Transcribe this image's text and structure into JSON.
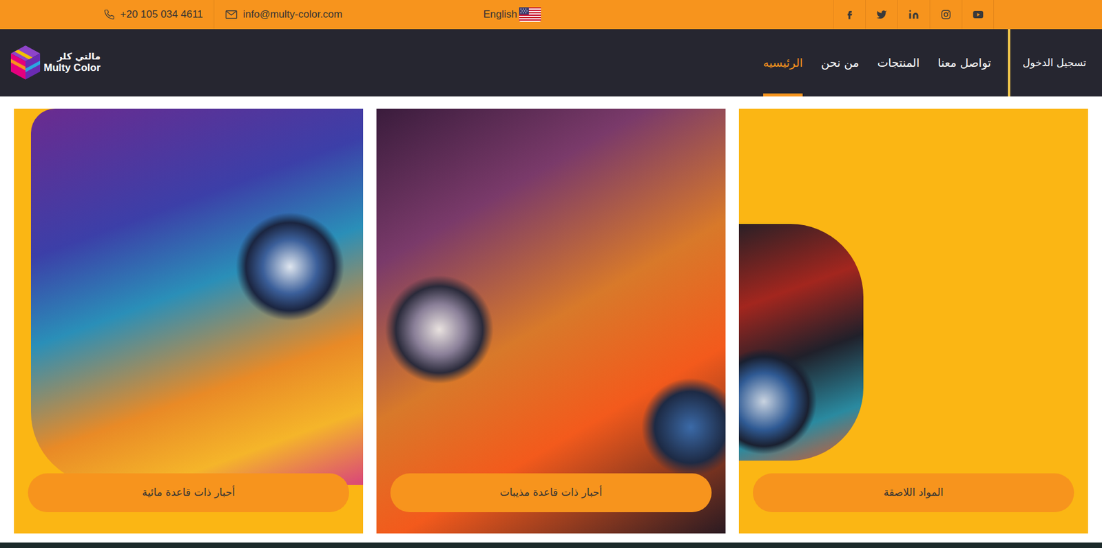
{
  "top_bar": {
    "phone": "+20 105 034 4611",
    "email": "info@multy-color.com",
    "language": "English"
  },
  "logo": {
    "arabic": "مالتي كلر",
    "latin": "Multy Color"
  },
  "nav": {
    "items": [
      {
        "label": "الرئيسيه",
        "selected": true
      },
      {
        "label": "من نحن",
        "selected": false
      },
      {
        "label": "المنتجات",
        "selected": false
      },
      {
        "label": "تواصل معنا",
        "selected": false
      }
    ],
    "login": "تسجيل الدخول"
  },
  "cards": [
    {
      "label": "أحبار ذات قاعدة مائية"
    },
    {
      "label": "أحبار ذات قاعدة مذيبات"
    },
    {
      "label": "المواد اللاصقة"
    }
  ]
}
